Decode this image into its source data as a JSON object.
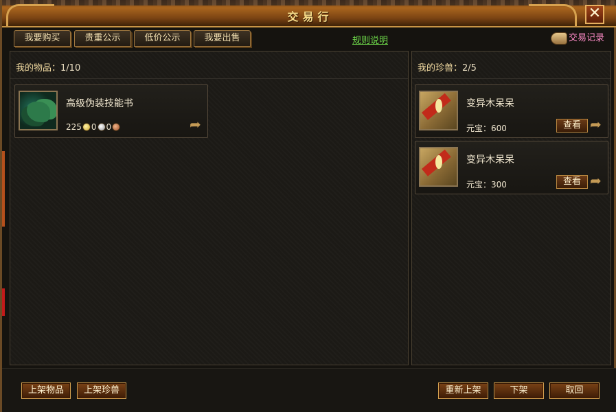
{
  "window": {
    "title": "交易行",
    "close_glyph": "✕"
  },
  "tabs": [
    {
      "label": "我要购买"
    },
    {
      "label": "贵重公示"
    },
    {
      "label": "低价公示"
    },
    {
      "label": "我要出售"
    }
  ],
  "rules_link": "规则说明",
  "records_link": "交易记录",
  "left_panel": {
    "header_label": "我的物品：",
    "count": "1/10",
    "items": [
      {
        "name": "高级伪装技能书",
        "icon": "skill-book-icon",
        "price_gold": "225",
        "price_silver": "0",
        "price_copper": "0"
      }
    ]
  },
  "right_panel": {
    "header_label": "我的珍兽：",
    "count": "2/5",
    "pets": [
      {
        "name": "变异木呆呆",
        "price_label": "元宝：",
        "price": "600",
        "view_label": "查看",
        "icon": "pet-icon"
      },
      {
        "name": "变异木呆呆",
        "price_label": "元宝：",
        "price": "300",
        "view_label": "查看",
        "icon": "pet-icon"
      }
    ]
  },
  "bottom_buttons": {
    "list_item": "上架物品",
    "list_pet": "上架珍兽",
    "relist": "重新上架",
    "delist": "下架",
    "withdraw": "取回"
  },
  "colors": {
    "accent_gold": "#f7dc8a",
    "link_green": "#6ed84a",
    "records_pink": "#ff8cc8"
  }
}
